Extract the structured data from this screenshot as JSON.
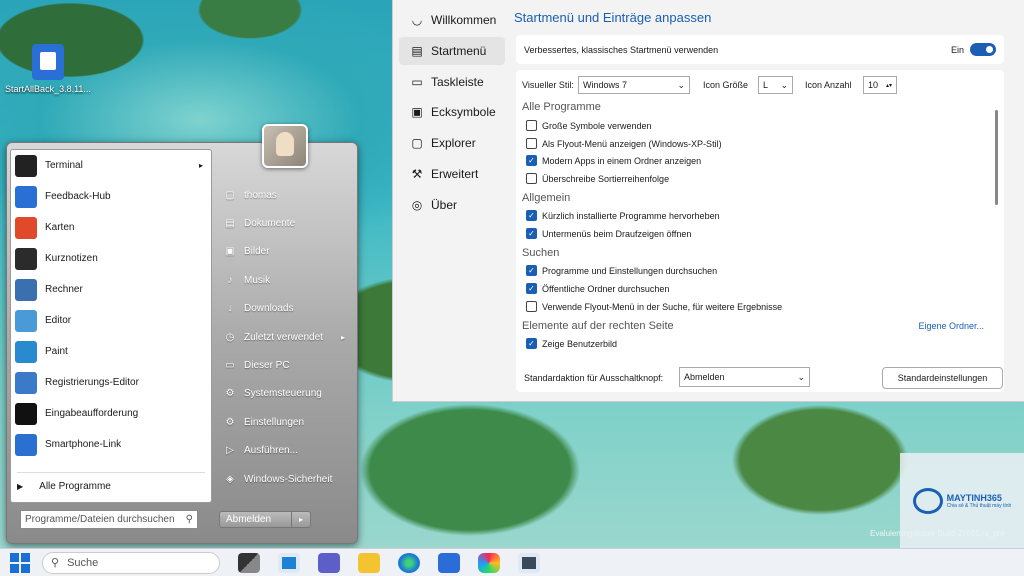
{
  "desktop": {
    "icon_label": "StartAllBack_3.8.11..."
  },
  "startmenu": {
    "programs": [
      {
        "label": "Terminal",
        "icon": "terminal-icon",
        "color": "#222222",
        "arrow": "▸"
      },
      {
        "label": "Feedback-Hub",
        "icon": "feedback-icon",
        "color": "#2a6fd6",
        "arrow": ""
      },
      {
        "label": "Karten",
        "icon": "map-pin-icon",
        "color": "#e04a2a",
        "arrow": ""
      },
      {
        "label": "Kurznotizen",
        "icon": "sticky-notes-icon",
        "color": "#2b2b2b",
        "arrow": ""
      },
      {
        "label": "Rechner",
        "icon": "calculator-icon",
        "color": "#3a6fb0",
        "arrow": ""
      },
      {
        "label": "Editor",
        "icon": "notepad-icon",
        "color": "#4a9ad8",
        "arrow": ""
      },
      {
        "label": "Paint",
        "icon": "paint-icon",
        "color": "#2a8ad0",
        "arrow": ""
      },
      {
        "label": "Registrierungs-Editor",
        "icon": "registry-icon",
        "color": "#3a7ac8",
        "arrow": ""
      },
      {
        "label": "Eingabeaufforderung",
        "icon": "cmd-icon",
        "color": "#111111",
        "arrow": ""
      },
      {
        "label": "Smartphone-Link",
        "icon": "phone-link-icon",
        "color": "#2a70d0",
        "arrow": ""
      }
    ],
    "all_programs": "Alle Programme",
    "search_placeholder": "Programme/Dateien durchsuchen",
    "right_items": [
      {
        "label": "thomas",
        "icon": "folder-icon",
        "glyph": "▢",
        "arrow": ""
      },
      {
        "label": "Dokumente",
        "icon": "documents-icon",
        "glyph": "▤",
        "arrow": ""
      },
      {
        "label": "Bilder",
        "icon": "pictures-icon",
        "glyph": "▣",
        "arrow": ""
      },
      {
        "label": "Musik",
        "icon": "music-icon",
        "glyph": "♪",
        "arrow": ""
      },
      {
        "label": "Downloads",
        "icon": "download-icon",
        "glyph": "↓",
        "arrow": ""
      },
      {
        "label": "Zuletzt verwendet",
        "icon": "clock-icon",
        "glyph": "◷",
        "arrow": "▸"
      },
      {
        "label": "Dieser PC",
        "icon": "pc-icon",
        "glyph": "▭",
        "arrow": ""
      },
      {
        "label": "Systemsteuerung",
        "icon": "control-panel-icon",
        "glyph": "⚙",
        "arrow": ""
      },
      {
        "label": "Einstellungen",
        "icon": "settings-icon",
        "glyph": "⚙",
        "arrow": ""
      },
      {
        "label": "Ausführen...",
        "icon": "run-icon",
        "glyph": "▷",
        "arrow": ""
      },
      {
        "label": "Windows-Sicherheit",
        "icon": "shield-icon",
        "glyph": "◈",
        "arrow": ""
      }
    ],
    "shutdown_label": "Abmelden"
  },
  "settings": {
    "nav": [
      {
        "label": "Willkommen",
        "icon": "welcome-icon",
        "glyph": "◡"
      },
      {
        "label": "Startmenü",
        "icon": "start-menu-icon",
        "glyph": "▤"
      },
      {
        "label": "Taskleiste",
        "icon": "taskbar-icon",
        "glyph": "▭"
      },
      {
        "label": "Ecksymbole",
        "icon": "tray-icon",
        "glyph": "▣"
      },
      {
        "label": "Explorer",
        "icon": "explorer-icon",
        "glyph": "▢"
      },
      {
        "label": "Erweitert",
        "icon": "wrench-icon",
        "glyph": "⚒"
      },
      {
        "label": "Über",
        "icon": "about-icon",
        "glyph": "◎"
      }
    ],
    "title": "Startmenü und Einträge anpassen",
    "classic_label": "Verbessertes, klassisches Startmenü verwenden",
    "classic_state": "Ein",
    "visual_style_label": "Visueller Stil:",
    "visual_style_value": "Windows 7",
    "icon_size_label": "Icon Größe",
    "icon_size_value": "L",
    "icon_count_label": "Icon Anzahl",
    "icon_count_value": "10",
    "sections": {
      "all_programs": "Alle Programme",
      "general": "Allgemein",
      "search": "Suchen",
      "right_side": "Elemente auf der rechten Seite"
    },
    "checks": [
      {
        "label": "Große Symbole verwenden",
        "checked": false
      },
      {
        "label": "Als Flyout-Menü anzeigen (Windows-XP-Stil)",
        "checked": false
      },
      {
        "label": "Modern Apps in einem Ordner anzeigen",
        "checked": true
      },
      {
        "label": "Überschreibe Sortierreihenfolge",
        "checked": false
      },
      {
        "label": "Kürzlich installierte Programme hervorheben",
        "checked": true
      },
      {
        "label": "Untermenüs beim Draufzeigen öffnen",
        "checked": true
      },
      {
        "label": "Programme und Einstellungen durchsuchen",
        "checked": true
      },
      {
        "label": "Öffentliche Ordner durchsuchen",
        "checked": true
      },
      {
        "label": "Verwende Flyout-Menü in der Suche, für weitere Ergebnisse",
        "checked": false
      },
      {
        "label": "Zeige Benutzerbild",
        "checked": true
      }
    ],
    "custom_folders_link": "Eigene Ordner...",
    "shutdown_action_label": "Standardaktion für Ausschaltknopf:",
    "shutdown_action_value": "Abmelden",
    "defaults_button": "Standardeinstellungen"
  },
  "watermark": {
    "brand": "MAYTINH365",
    "tagline": "Chia sẻ & Thủ thuật máy tính"
  },
  "eval_text": "Evaluierungskopie Build 27695.rs_pre",
  "taskbar": {
    "search_placeholder": "Suche"
  }
}
